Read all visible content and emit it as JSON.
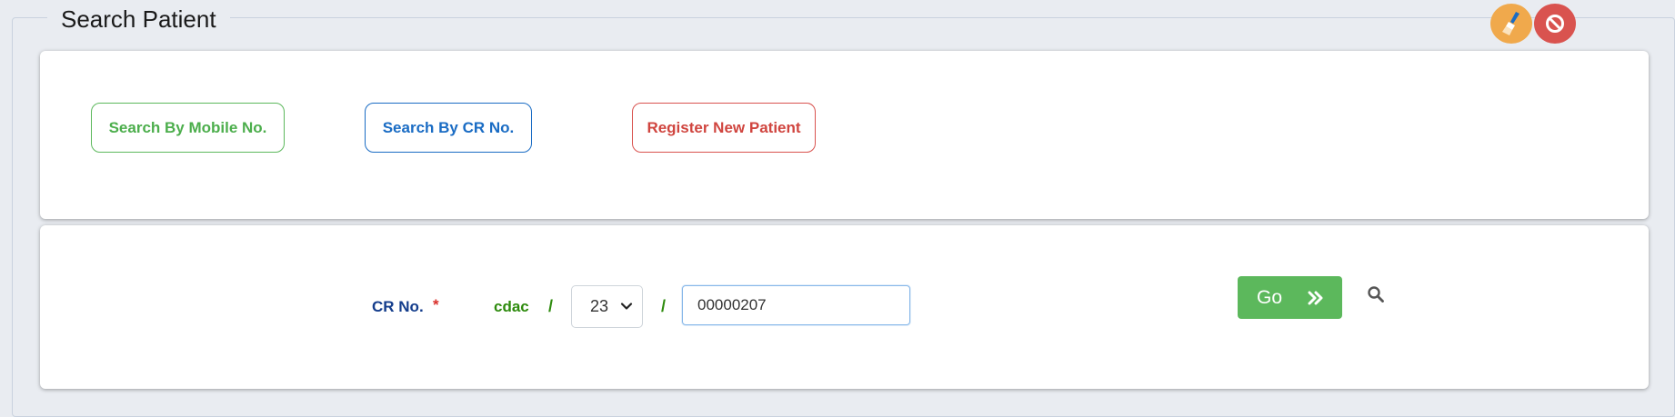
{
  "fieldset": {
    "legend": "Search Patient"
  },
  "top_actions": {
    "clear_icon": "broom-icon",
    "cancel_icon": "ban-icon",
    "colors": {
      "clear": "#f0a94c",
      "cancel": "#d9534f"
    }
  },
  "search_options": [
    {
      "label": "Search By Mobile No.",
      "color": "#5cb85c"
    },
    {
      "label": "Search By CR No.",
      "color": "#1a6cc4"
    },
    {
      "label": "Register New Patient",
      "color": "#d9534f"
    }
  ],
  "cr_form": {
    "label": "CR No.",
    "required_mark": "*",
    "hospital_code": "cdac",
    "separator": "/",
    "year_options": [
      "23"
    ],
    "year_selected": "23",
    "cr_value": "00000207",
    "go_label": "Go",
    "go_icon": "double-chevron-right-icon",
    "search_icon": "search-icon"
  },
  "colors": {
    "go_button": "#5cb85c",
    "label_blue": "#143d8c",
    "required_red": "#d9302b",
    "hospital_green": "#2e8b0e"
  }
}
